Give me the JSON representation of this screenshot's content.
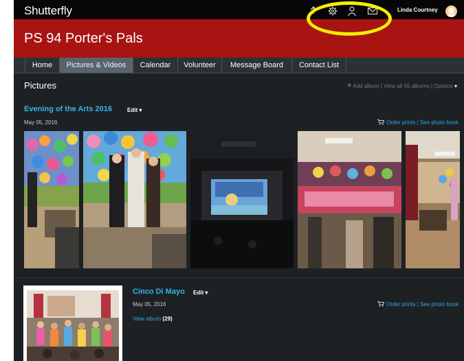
{
  "app": {
    "logo": "Shutterfly"
  },
  "header": {
    "icons": [
      "upload-icon",
      "gear-icon",
      "person-icon",
      "mail-icon"
    ],
    "user_name": "Linda Courtney"
  },
  "site": {
    "title": "PS 94 Porter's Pals"
  },
  "nav": [
    {
      "label": "Home",
      "active": false
    },
    {
      "label": "Pictures & Videos",
      "active": true
    },
    {
      "label": "Calendar",
      "active": false
    },
    {
      "label": "Volunteer",
      "active": false
    },
    {
      "label": "Message Board",
      "active": false
    },
    {
      "label": "Contact List",
      "active": false
    }
  ],
  "pictures": {
    "title": "Pictures",
    "add_album": "Add album",
    "view_all": "View all 65 albums",
    "options": "Options"
  },
  "albums": [
    {
      "title": "Evening of the Arts 2016",
      "edit": "Edit",
      "date": "May 05, 2016",
      "order_prints": "Order prints",
      "see_photo_book": "See photo book"
    },
    {
      "title": "Cinco Di Mayo",
      "edit": "Edit",
      "date": "May 05, 2016",
      "order_prints": "Order prints",
      "see_photo_book": "See photo book",
      "view_album": "View album",
      "photo_count": "(29)"
    }
  ],
  "colors": {
    "topbar": "#060606",
    "banner": "#a71412",
    "navbar": "#2a3137",
    "page_bg": "#1e2124",
    "link": "#2ea7e0",
    "add_green": "#8fc63f",
    "highlight_circle": "#f6ee00"
  }
}
